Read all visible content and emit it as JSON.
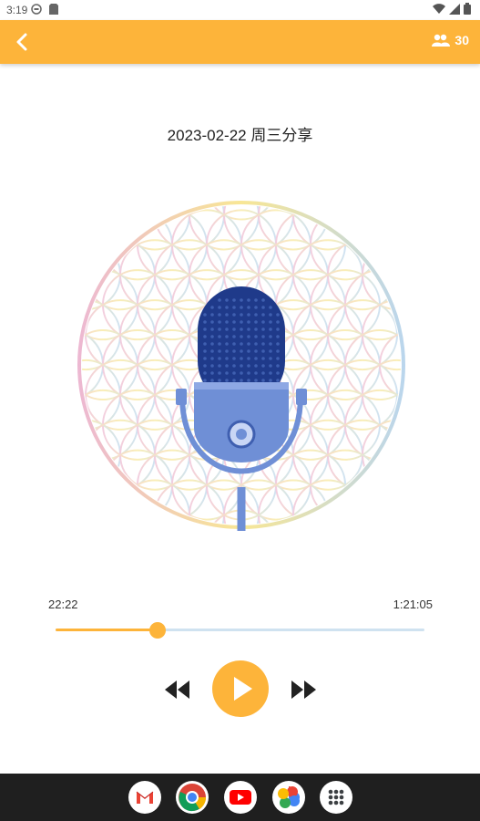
{
  "status_bar": {
    "time": "3:19"
  },
  "app_bar": {
    "listener_count": "30"
  },
  "episode": {
    "title": "2023-02-22 周三分享"
  },
  "player": {
    "current_time": "22:22",
    "total_time": "1:21:05",
    "progress_fraction": 0.2755,
    "state": "paused"
  },
  "colors": {
    "accent": "#fdb43a",
    "track": "#cfe2f0",
    "mic_dark": "#1f3a8a",
    "mic_light": "#6f8fd6"
  },
  "dock": {
    "apps": [
      "gmail-icon",
      "chrome-icon",
      "youtube-icon",
      "photos-icon",
      "app-drawer-icon"
    ]
  }
}
